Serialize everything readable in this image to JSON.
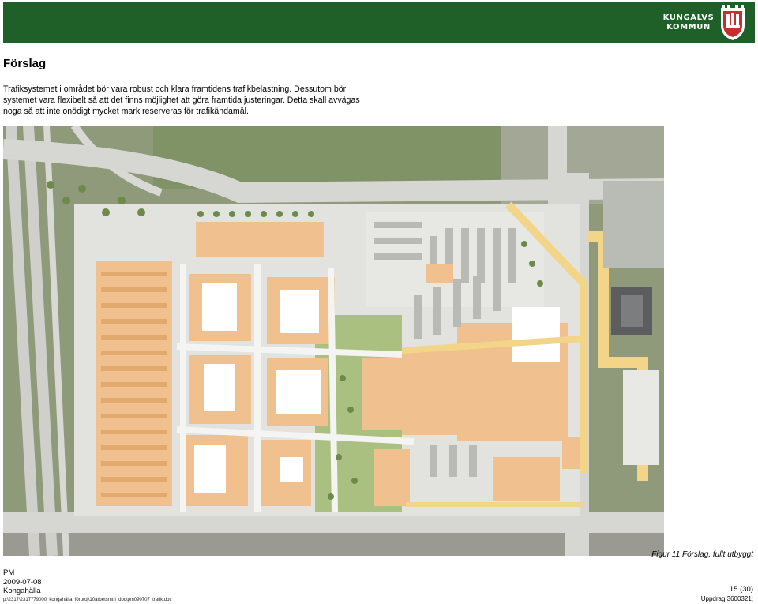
{
  "header": {
    "logo_text_line1": "KUNGÄLVS",
    "logo_text_line2": "KOMMUN"
  },
  "document": {
    "title": "Förslag",
    "intro": "Trafiksystemet i området bör vara robust och klara framtidens trafikbelastning. Dessutom bör systemet vara flexibelt så att det finns möjlighet att göra framtida justeringar. Detta skall avvägas noga så att inte onödigt mycket mark reserveras för trafikändamål.",
    "figure_caption": "Figur 11 Förslag, fullt utbyggt"
  },
  "footer": {
    "doc_type": "PM",
    "date": "2009-07-08",
    "place": "Kongahälla",
    "path": "p:\\2317\\2317779000_kongahälla_förproj\\10arbetsmtrl_doc\\pm090707_trafik.doc",
    "page": "15 (30)",
    "assignment": "Uppdrag 3600321;"
  },
  "colors": {
    "header_green": "#1f5f28",
    "building_beige": "#f0c08e",
    "road_grey": "#d6d6d2",
    "grass_green": "#9fb77a",
    "path_yellow": "#f3d58a"
  }
}
